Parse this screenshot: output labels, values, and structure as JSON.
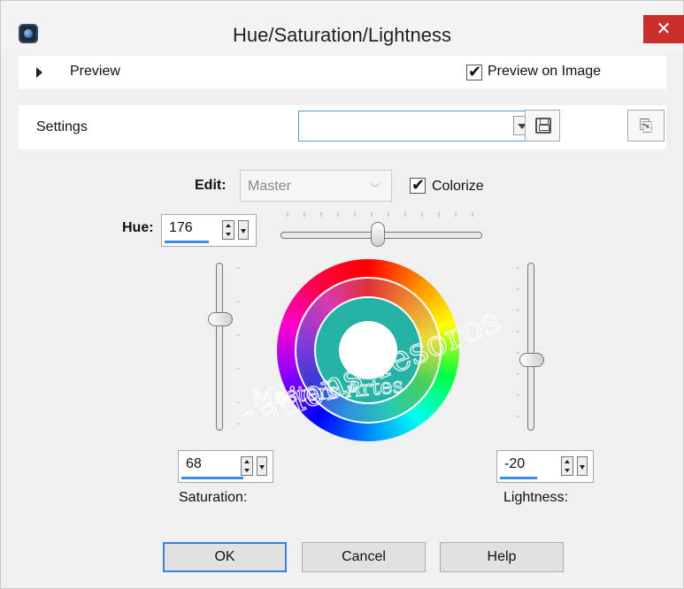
{
  "window": {
    "title": "Hue/Saturation/Lightness",
    "close_label": "✕"
  },
  "preview": {
    "label": "Preview",
    "preview_on_image_label": "Preview on Image",
    "preview_on_image_checked": true
  },
  "settings": {
    "label": "Settings",
    "preset_value": ""
  },
  "edit": {
    "label": "Edit:",
    "value": "Master",
    "colorize_label": "Colorize",
    "colorize_checked": true
  },
  "hue": {
    "label": "Hue:",
    "value": "176"
  },
  "saturation": {
    "label": "Saturation:",
    "value": "68"
  },
  "lightness": {
    "label": "Lightness:",
    "value": "-20"
  },
  "buttons": {
    "ok": "OK",
    "cancel": "Cancel",
    "help": "Help"
  },
  "watermark": {
    "line1": "Creations Tesoros",
    "line2": "Masters Artes"
  },
  "colors": {
    "accent": "#3a8ee6",
    "close": "#c9302c",
    "inner_ring": "#26b3a6"
  }
}
